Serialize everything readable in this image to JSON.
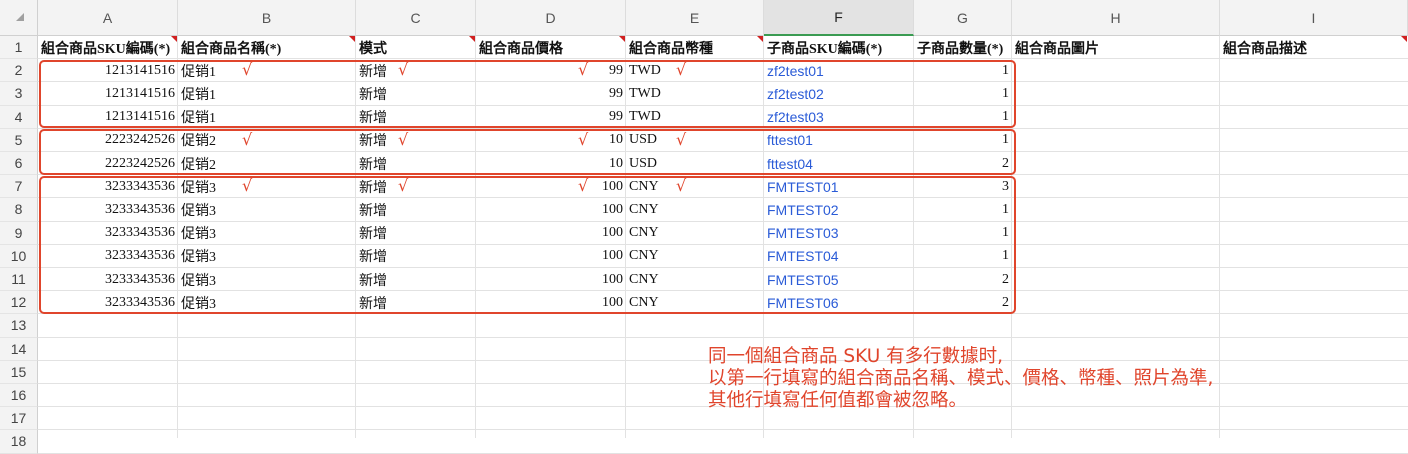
{
  "column_headers": [
    "A",
    "B",
    "C",
    "D",
    "E",
    "F",
    "G",
    "H",
    "I"
  ],
  "selected_column": "F",
  "row_numbers": [
    "1",
    "2",
    "3",
    "4",
    "5",
    "6",
    "7",
    "8",
    "9",
    "10",
    "11",
    "12",
    "13",
    "14",
    "15",
    "16",
    "17",
    "18"
  ],
  "header_row": {
    "a": "組合商品SKU編碼(*)",
    "b": "組合商品名稱(*)",
    "c": "模式",
    "d": "組合商品價格",
    "e": "組合商品幣種",
    "f": "子商品SKU編碼(*)",
    "g": "子商品數量(*)",
    "h": "組合商品圖片",
    "i": "組合商品描述"
  },
  "rows": [
    {
      "sku": "1213141516",
      "name": "促销1",
      "mode": "新增",
      "price": "99",
      "currency": "TWD",
      "child_sku": "zf2test01",
      "qty": "1"
    },
    {
      "sku": "1213141516",
      "name": "促销1",
      "mode": "新增",
      "price": "99",
      "currency": "TWD",
      "child_sku": "zf2test02",
      "qty": "1"
    },
    {
      "sku": "1213141516",
      "name": "促销1",
      "mode": "新增",
      "price": "99",
      "currency": "TWD",
      "child_sku": "zf2test03",
      "qty": "1"
    },
    {
      "sku": "2223242526",
      "name": "促销2",
      "mode": "新增",
      "price": "10",
      "currency": "USD",
      "child_sku": "fttest01",
      "qty": "1"
    },
    {
      "sku": "2223242526",
      "name": "促销2",
      "mode": "新增",
      "price": "10",
      "currency": "USD",
      "child_sku": "fttest04",
      "qty": "2"
    },
    {
      "sku": "3233343536",
      "name": "促销3",
      "mode": "新增",
      "price": "100",
      "currency": "CNY",
      "child_sku": "FMTEST01",
      "qty": "3"
    },
    {
      "sku": "3233343536",
      "name": "促销3",
      "mode": "新增",
      "price": "100",
      "currency": "CNY",
      "child_sku": "FMTEST02",
      "qty": "1"
    },
    {
      "sku": "3233343536",
      "name": "促销3",
      "mode": "新增",
      "price": "100",
      "currency": "CNY",
      "child_sku": "FMTEST03",
      "qty": "1"
    },
    {
      "sku": "3233343536",
      "name": "促销3",
      "mode": "新增",
      "price": "100",
      "currency": "CNY",
      "child_sku": "FMTEST04",
      "qty": "1"
    },
    {
      "sku": "3233343536",
      "name": "促销3",
      "mode": "新增",
      "price": "100",
      "currency": "CNY",
      "child_sku": "FMTEST05",
      "qty": "2"
    },
    {
      "sku": "3233343536",
      "name": "促销3",
      "mode": "新增",
      "price": "100",
      "currency": "CNY",
      "child_sku": "FMTEST06",
      "qty": "2"
    }
  ],
  "check_glyph": "√",
  "annotation": [
    "同一個組合商品 SKU 有多行數據时,",
    "以第一行填寫的組合商品名稱、模式、價格、幣種、照片為準,",
    "其他行填寫任何值都會被忽略。"
  ],
  "colors": {
    "annotation_red": "#e0452c",
    "link_blue": "#2a5bd7",
    "selected_column_underline": "#3a9b52"
  }
}
